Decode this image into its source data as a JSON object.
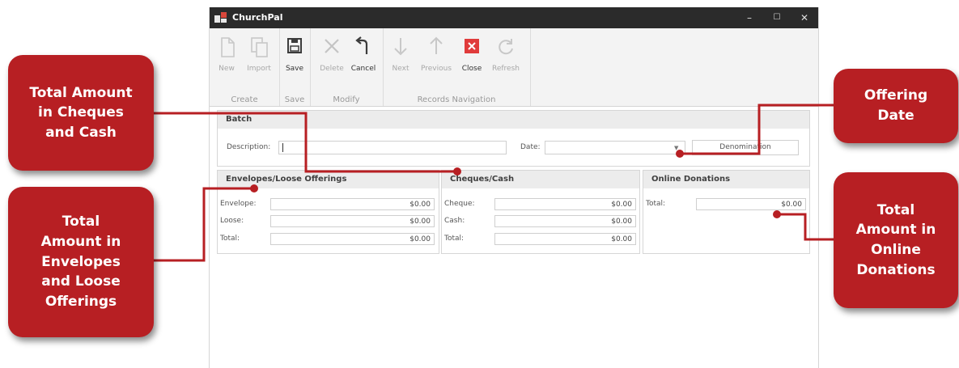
{
  "window": {
    "title": "ChurchPal",
    "minimize": "–",
    "maximize": "☐",
    "close": "✕"
  },
  "ribbon": {
    "groups": [
      {
        "caption": "Create",
        "buttons": [
          {
            "label": "New",
            "icon": "document-icon"
          },
          {
            "label": "Import",
            "icon": "copy-icon"
          }
        ]
      },
      {
        "caption": "Save",
        "buttons": [
          {
            "label": "Save",
            "icon": "floppy-icon"
          }
        ]
      },
      {
        "caption": "Modify",
        "buttons": [
          {
            "label": "Delete",
            "icon": "x-icon"
          },
          {
            "label": "Cancel",
            "icon": "undo-icon"
          }
        ]
      },
      {
        "caption": "Records Navigation",
        "buttons": [
          {
            "label": "Next",
            "icon": "arrow-down-icon"
          },
          {
            "label": "Previous",
            "icon": "arrow-up-icon"
          },
          {
            "label": "Close",
            "icon": "close-red-icon"
          },
          {
            "label": "Refresh",
            "icon": "refresh-icon"
          }
        ]
      }
    ]
  },
  "batch": {
    "header": "Batch",
    "description_label": "Description:",
    "description_value": "",
    "date_label": "Date:",
    "date_value": "",
    "denomination_button": "Denomination"
  },
  "envelopes": {
    "header": "Envelopes/Loose Offerings",
    "rows": [
      {
        "label": "Envelope:",
        "value": "$0.00"
      },
      {
        "label": "Loose:",
        "value": "$0.00"
      },
      {
        "label": "Total:",
        "value": "$0.00"
      }
    ]
  },
  "cheques": {
    "header": "Cheques/Cash",
    "rows": [
      {
        "label": "Cheque:",
        "value": "$0.00"
      },
      {
        "label": "Cash:",
        "value": "$0.00"
      },
      {
        "label": "Total:",
        "value": "$0.00"
      }
    ]
  },
  "online": {
    "header": "Online Donations",
    "rows": [
      {
        "label": "Total:",
        "value": "$0.00"
      }
    ]
  },
  "callouts": {
    "cheques_cash": [
      "Total Amount",
      "in Cheques",
      "and Cash"
    ],
    "envelopes_loose": [
      "Total",
      "Amount in",
      "Envelopes",
      "and Loose",
      "Offerings"
    ],
    "offering_date": [
      "Offering",
      "Date"
    ],
    "online_donations": [
      "Total",
      "Amount in",
      "Online",
      "Donations"
    ]
  },
  "colors": {
    "callout": "#b71f23",
    "titlebar": "#2b2b2b",
    "close_icon": "#e03b3b"
  }
}
